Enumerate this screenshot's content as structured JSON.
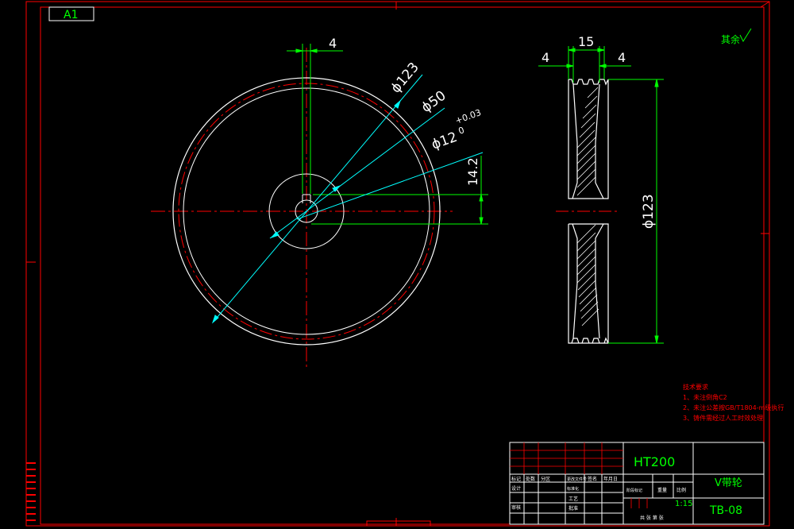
{
  "sheet": {
    "size_label": "A1"
  },
  "front_view": {
    "dims": {
      "keyway_width": "4",
      "outer_diameter": "ϕ123",
      "hub_diameter": "ϕ50",
      "bore_diameter": "ϕ12",
      "bore_tol_upper": "+0.03",
      "bore_tol_lower": "0",
      "key_height": "14.2"
    }
  },
  "side_view": {
    "dims": {
      "overall_width": "15",
      "left_offset": "4",
      "right_offset": "4",
      "diameter": "ϕ123"
    }
  },
  "roughness_note": "其余",
  "tech_requirements": {
    "title": "技术要求",
    "items": [
      "1、未注倒角C2",
      "2、未注公差按GB/T1804-m级执行",
      "3、铸件需经过人工时效处理"
    ]
  },
  "title_block": {
    "material": "HT200",
    "part_name": "V带轮",
    "drawing_no": "TB-08",
    "scale": "1:15",
    "rev_headers": [
      "标记",
      "处数",
      "分区",
      "更改文件号",
      "签名",
      "年月日"
    ],
    "role_labels": [
      "设计",
      "审核",
      "工艺",
      "批准",
      "标准化"
    ],
    "stage_headers": [
      "阶段标记",
      "重量",
      "比例"
    ],
    "sheet_info": "共 张 第 张"
  },
  "colors": {
    "frame": "#ff0000",
    "outline": "#ffffff",
    "dimension": "#00ff00",
    "leader": "#00ffff",
    "center": "#ff0000",
    "note": "#ff0000"
  }
}
